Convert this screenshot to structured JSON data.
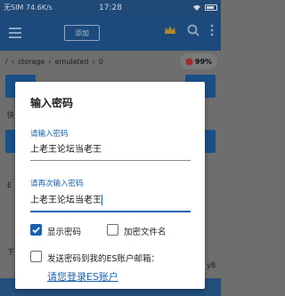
{
  "status_bar": {
    "left": "无SIM 74.6K/s",
    "time": "17:28"
  },
  "toolbar": {
    "tab_label": "添加"
  },
  "breadcrumb": {
    "root": "/",
    "items": [
      "storage",
      "emulated",
      "0"
    ]
  },
  "storage": {
    "percent": "99%"
  },
  "background_labels": {
    "left1": "快",
    "left2": "E",
    "left3": "下",
    "right_bottom": "yB"
  },
  "dialog": {
    "title": "输入密码",
    "field1": {
      "label": "请输入密码",
      "value": "上老王论坛当老王"
    },
    "field2": {
      "label": "请再次输入密码",
      "value": "上老王论坛当老王"
    },
    "checkboxes": {
      "show_password": {
        "label": "显示密码",
        "checked": true
      },
      "encrypt_filename": {
        "label": "加密文件名",
        "checked": false
      },
      "send_to_email": {
        "label": "发送密码到我的ES账户邮箱：",
        "checked": false
      }
    },
    "login_link": "请您登录ES账户"
  },
  "colors": {
    "accent": "#1a62b0",
    "toolbar": "#1d4a7c"
  }
}
